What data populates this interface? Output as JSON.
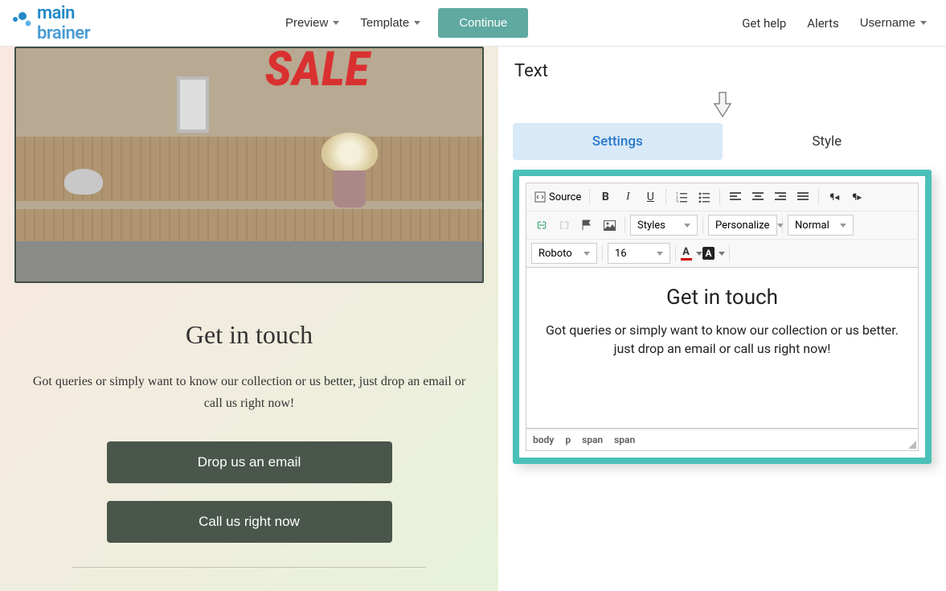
{
  "header": {
    "logo_main": "main",
    "logo_brainer": "brainer",
    "preview": "Preview",
    "template": "Template",
    "continue": "Continue",
    "get_help": "Get help",
    "alerts": "Alerts",
    "username": "Username"
  },
  "left": {
    "sale": "SALE",
    "title": "Get in touch",
    "body": "Got queries or simply want to know our collection or us better, just drop an email or call us right now!",
    "btn_email": "Drop us an email",
    "btn_call": "Call us right now"
  },
  "right": {
    "panel_title": "Text",
    "tabs": {
      "settings": "Settings",
      "style": "Style"
    },
    "toolbar": {
      "source": "Source",
      "styles": "Styles",
      "personalize": "Personalize",
      "block": "Normal",
      "font": "Roboto",
      "size": "16"
    },
    "editor": {
      "heading": "Get in touch",
      "body": "Got queries or simply want to know our collection or us better. just drop an email or call us right now!"
    },
    "status": [
      "body",
      "p",
      "span",
      "span"
    ]
  }
}
